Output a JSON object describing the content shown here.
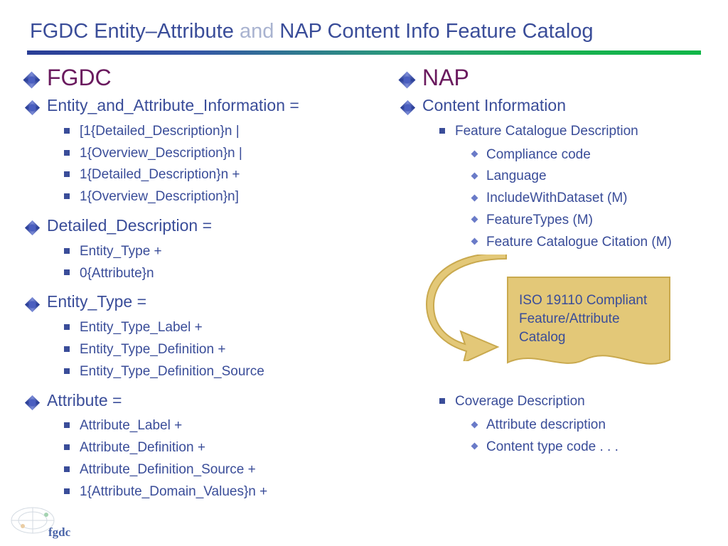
{
  "title": {
    "part1": "FGDC Entity–Attribute ",
    "and": "and",
    "part2": " NAP Content Info Feature Catalog"
  },
  "left": {
    "heading": "FGDC",
    "sections": [
      {
        "label": "Entity_and_Attribute_Information =",
        "items": [
          "[1{Detailed_Description}n |",
          "1{Overview_Description}n |",
          "1{Detailed_Description}n +",
          "1{Overview_Description}n]"
        ]
      },
      {
        "label": "Detailed_Description =",
        "items": [
          "Entity_Type +",
          "0{Attribute}n"
        ]
      },
      {
        "label": "Entity_Type =",
        "items": [
          "Entity_Type_Label +",
          "Entity_Type_Definition +",
          "Entity_Type_Definition_Source"
        ]
      },
      {
        "label": "Attribute =",
        "items": [
          "Attribute_Label +",
          "Attribute_Definition +",
          "Attribute_Definition_Source +",
          "1{Attribute_Domain_Values}n +"
        ]
      }
    ]
  },
  "right": {
    "heading": "NAP",
    "section_label": "Content Information",
    "feature_catalogue": {
      "label": "Feature Catalogue Description",
      "items": [
        "Compliance code",
        "Language",
        "IncludeWithDataset (M)",
        "FeatureTypes (M)",
        "Feature Catalogue Citation (M)"
      ]
    },
    "callout": "ISO 19110 Compliant Feature/Attribute Catalog",
    "coverage": {
      "label": "Coverage Description",
      "items": [
        "Attribute description",
        "Content type code . . ."
      ]
    }
  },
  "logo_text": "fgdc"
}
